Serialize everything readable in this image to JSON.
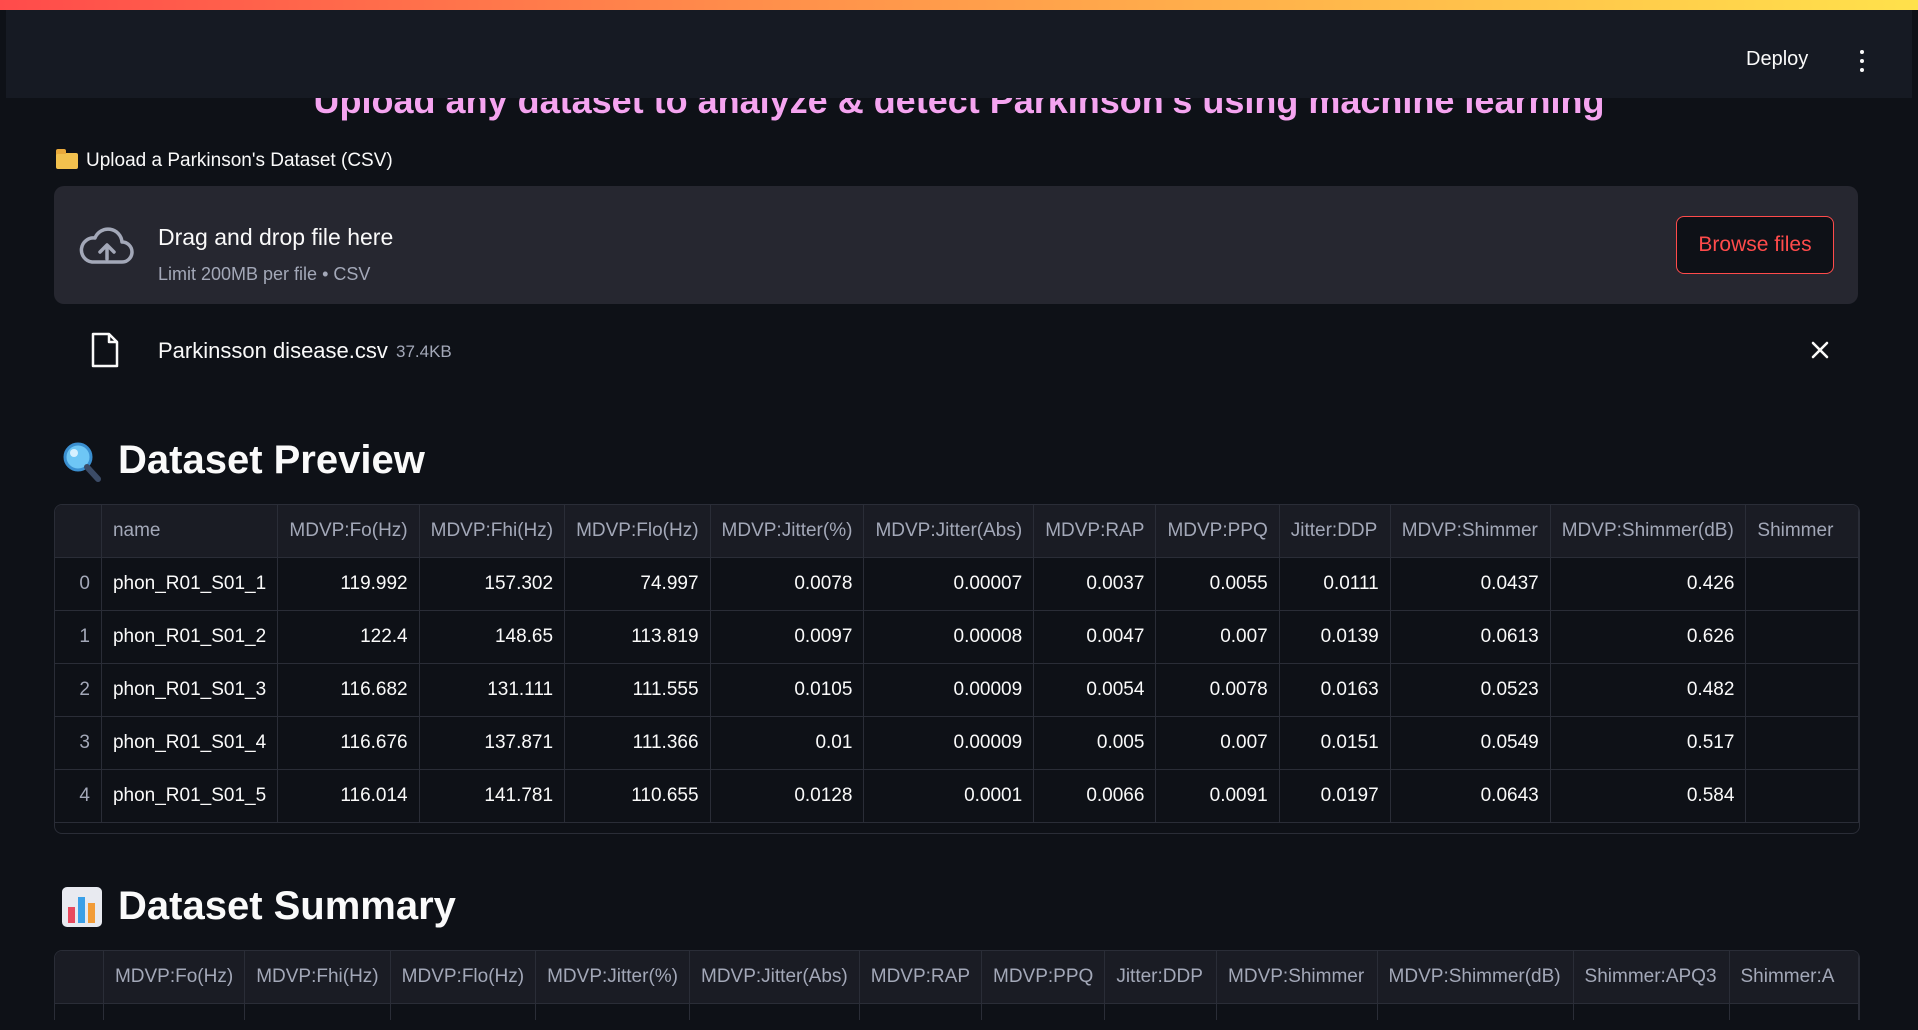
{
  "header": {
    "deploy_label": "Deploy"
  },
  "hero_text": "Upload any dataset to analyze & detect Parkinson's using machine learning",
  "uploader": {
    "label": "Upload a Parkinson's Dataset (CSV)",
    "drop_title": "Drag and drop file here",
    "drop_sub": "Limit 200MB per file • CSV",
    "browse_label": "Browse files"
  },
  "file": {
    "name": "Parkinsson disease.csv",
    "size": "37.4KB"
  },
  "preview": {
    "title": "Dataset Preview",
    "columns": [
      "name",
      "MDVP:Fo(Hz)",
      "MDVP:Fhi(Hz)",
      "MDVP:Flo(Hz)",
      "MDVP:Jitter(%)",
      "MDVP:Jitter(Abs)",
      "MDVP:RAP",
      "MDVP:PPQ",
      "Jitter:DDP",
      "MDVP:Shimmer",
      "MDVP:Shimmer(dB)",
      "Shimmer"
    ],
    "rows": [
      [
        "0",
        "phon_R01_S01_1",
        "119.992",
        "157.302",
        "74.997",
        "0.0078",
        "0.00007",
        "0.0037",
        "0.0055",
        "0.0111",
        "0.0437",
        "0.426",
        ""
      ],
      [
        "1",
        "phon_R01_S01_2",
        "122.4",
        "148.65",
        "113.819",
        "0.0097",
        "0.00008",
        "0.0047",
        "0.007",
        "0.0139",
        "0.0613",
        "0.626",
        ""
      ],
      [
        "2",
        "phon_R01_S01_3",
        "116.682",
        "131.111",
        "111.555",
        "0.0105",
        "0.00009",
        "0.0054",
        "0.0078",
        "0.0163",
        "0.0523",
        "0.482",
        ""
      ],
      [
        "3",
        "phon_R01_S01_4",
        "116.676",
        "137.871",
        "111.366",
        "0.01",
        "0.00009",
        "0.005",
        "0.007",
        "0.0151",
        "0.0549",
        "0.517",
        ""
      ],
      [
        "4",
        "phon_R01_S01_5",
        "116.014",
        "141.781",
        "110.655",
        "0.0128",
        "0.0001",
        "0.0066",
        "0.0091",
        "0.0197",
        "0.0643",
        "0.584",
        ""
      ]
    ]
  },
  "summary": {
    "title": "Dataset Summary",
    "columns": [
      "MDVP:Fo(Hz)",
      "MDVP:Fhi(Hz)",
      "MDVP:Flo(Hz)",
      "MDVP:Jitter(%)",
      "MDVP:Jitter(Abs)",
      "MDVP:RAP",
      "MDVP:PPQ",
      "Jitter:DDP",
      "MDVP:Shimmer",
      "MDVP:Shimmer(dB)",
      "Shimmer:APQ3",
      "Shimmer:A"
    ]
  }
}
